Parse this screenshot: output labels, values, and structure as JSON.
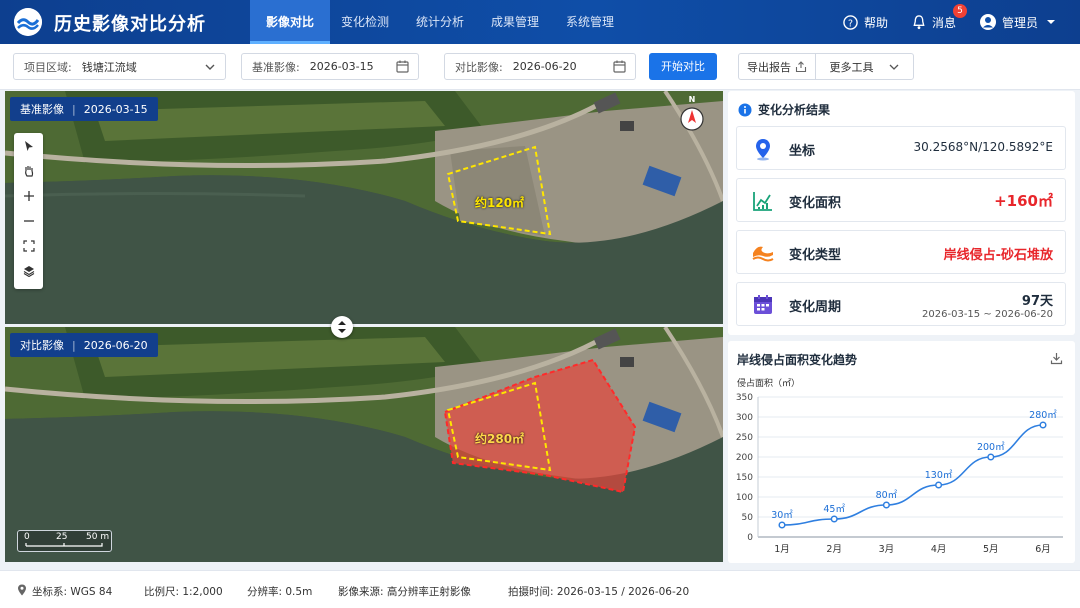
{
  "header": {
    "app_title": "历史影像对比分析",
    "nav": [
      "影像对比",
      "变化检测",
      "统计分析",
      "成果管理",
      "系统管理"
    ],
    "help": "帮助",
    "messages": "消息",
    "message_count": "5",
    "user": "管理员"
  },
  "toolbar": {
    "region_label": "项目区域:",
    "region_value": "钱塘江流域",
    "base_label": "基准影像:",
    "base_date": "2026-03-15",
    "compare_label": "对比影像:",
    "compare_date": "2026-06-20",
    "start_button": "开始对比",
    "export_button": "导出报告",
    "more_tools": "更多工具"
  },
  "maps": {
    "top_tag": "基准影像",
    "top_date": "2026-03-15",
    "top_area": "约120㎡",
    "bottom_tag": "对比影像",
    "bottom_date": "2026-06-20",
    "bottom_area": "约280㎡",
    "compass_n": "N",
    "scale_ticks": [
      "0",
      "25",
      "50 m"
    ]
  },
  "result": {
    "title": "变化分析结果",
    "coord_label": "坐标",
    "coord_value": "30.2568°N/120.5892°E",
    "area_label": "变化面积",
    "area_value": "+160㎡",
    "type_label": "变化类型",
    "type_value": "岸线侵占-砂石堆放",
    "period_label": "变化周期",
    "period_value": "97天",
    "period_range": "2026-03-15 ~ 2026-06-20"
  },
  "chart_data": {
    "type": "line",
    "title": "岸线侵占面积变化趋势",
    "ylabel": "侵占面积（㎡）",
    "categories": [
      "1月",
      "2月",
      "3月",
      "4月",
      "5月",
      "6月"
    ],
    "values": [
      30,
      45,
      80,
      130,
      200,
      280
    ],
    "data_labels": [
      "30㎡",
      "45㎡",
      "80㎡",
      "130㎡",
      "200㎡",
      "280㎡"
    ],
    "ylim": [
      0,
      350
    ],
    "yticks": [
      0,
      50,
      100,
      150,
      200,
      250,
      300,
      350
    ],
    "color": "#2f7fe0",
    "grid": true
  },
  "status": {
    "crs": "坐标系: WGS 84",
    "scale": "比例尺: 1:2,000",
    "resolution": "分辨率: 0.5m",
    "source": "影像来源: 高分辨率正射影像",
    "time": "拍摄时间: 2026-03-15 / 2026-06-20"
  }
}
